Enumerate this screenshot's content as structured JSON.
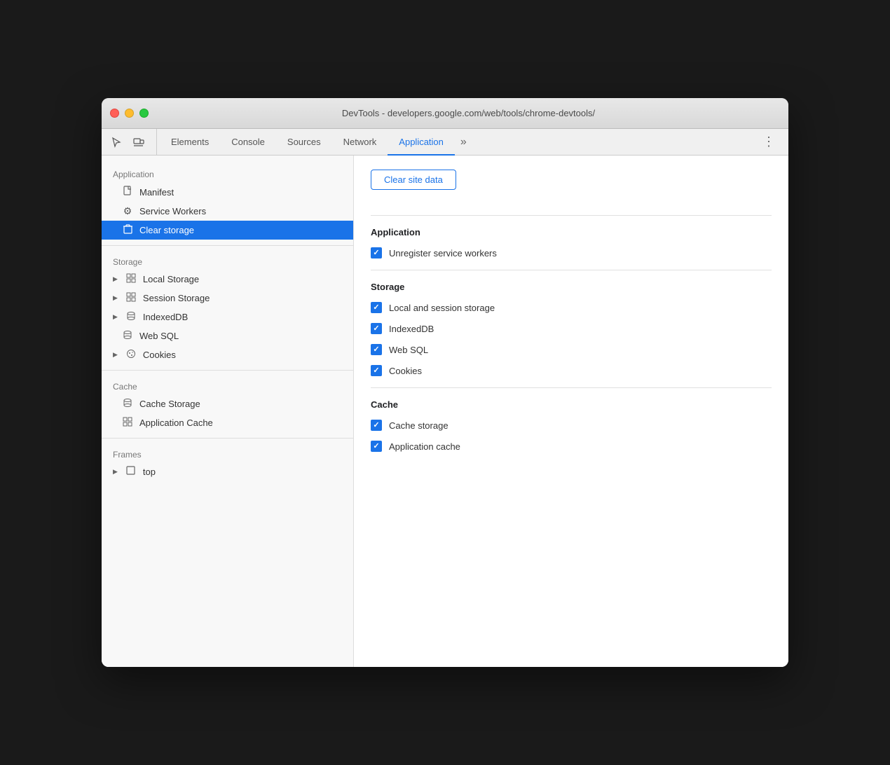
{
  "window": {
    "title": "DevTools - developers.google.com/web/tools/chrome-devtools/"
  },
  "tabs": [
    {
      "id": "elements",
      "label": "Elements",
      "active": false
    },
    {
      "id": "console",
      "label": "Console",
      "active": false
    },
    {
      "id": "sources",
      "label": "Sources",
      "active": false
    },
    {
      "id": "network",
      "label": "Network",
      "active": false
    },
    {
      "id": "application",
      "label": "Application",
      "active": true
    }
  ],
  "sidebar": {
    "sections": [
      {
        "title": "Application",
        "items": [
          {
            "id": "manifest",
            "label": "Manifest",
            "icon": "doc",
            "expandable": false,
            "active": false
          },
          {
            "id": "service-workers",
            "label": "Service Workers",
            "icon": "gear",
            "expandable": false,
            "active": false
          },
          {
            "id": "clear-storage",
            "label": "Clear storage",
            "icon": "trash",
            "expandable": false,
            "active": true
          }
        ]
      },
      {
        "title": "Storage",
        "items": [
          {
            "id": "local-storage",
            "label": "Local Storage",
            "icon": "grid",
            "expandable": true,
            "active": false
          },
          {
            "id": "session-storage",
            "label": "Session Storage",
            "icon": "grid",
            "expandable": true,
            "active": false
          },
          {
            "id": "indexeddb",
            "label": "IndexedDB",
            "icon": "cylinder",
            "expandable": true,
            "active": false
          },
          {
            "id": "web-sql",
            "label": "Web SQL",
            "icon": "cylinder",
            "expandable": false,
            "active": false
          },
          {
            "id": "cookies",
            "label": "Cookies",
            "icon": "cookie",
            "expandable": true,
            "active": false
          }
        ]
      },
      {
        "title": "Cache",
        "items": [
          {
            "id": "cache-storage",
            "label": "Cache Storage",
            "icon": "cylinder",
            "expandable": false,
            "active": false
          },
          {
            "id": "app-cache",
            "label": "Application Cache",
            "icon": "grid2",
            "expandable": false,
            "active": false
          }
        ]
      },
      {
        "title": "Frames",
        "items": [
          {
            "id": "top",
            "label": "top",
            "icon": "frame",
            "expandable": true,
            "active": false
          }
        ]
      }
    ]
  },
  "right_panel": {
    "clear_button_label": "Clear site data",
    "sections": [
      {
        "title": "Application",
        "checkboxes": [
          {
            "id": "unregister-sw",
            "label": "Unregister service workers",
            "checked": true
          }
        ]
      },
      {
        "title": "Storage",
        "checkboxes": [
          {
            "id": "local-session",
            "label": "Local and session storage",
            "checked": true
          },
          {
            "id": "indexeddb",
            "label": "IndexedDB",
            "checked": true
          },
          {
            "id": "web-sql",
            "label": "Web SQL",
            "checked": true
          },
          {
            "id": "cookies",
            "label": "Cookies",
            "checked": true
          }
        ]
      },
      {
        "title": "Cache",
        "checkboxes": [
          {
            "id": "cache-storage",
            "label": "Cache storage",
            "checked": true
          },
          {
            "id": "app-cache",
            "label": "Application cache",
            "checked": true
          }
        ]
      }
    ]
  }
}
